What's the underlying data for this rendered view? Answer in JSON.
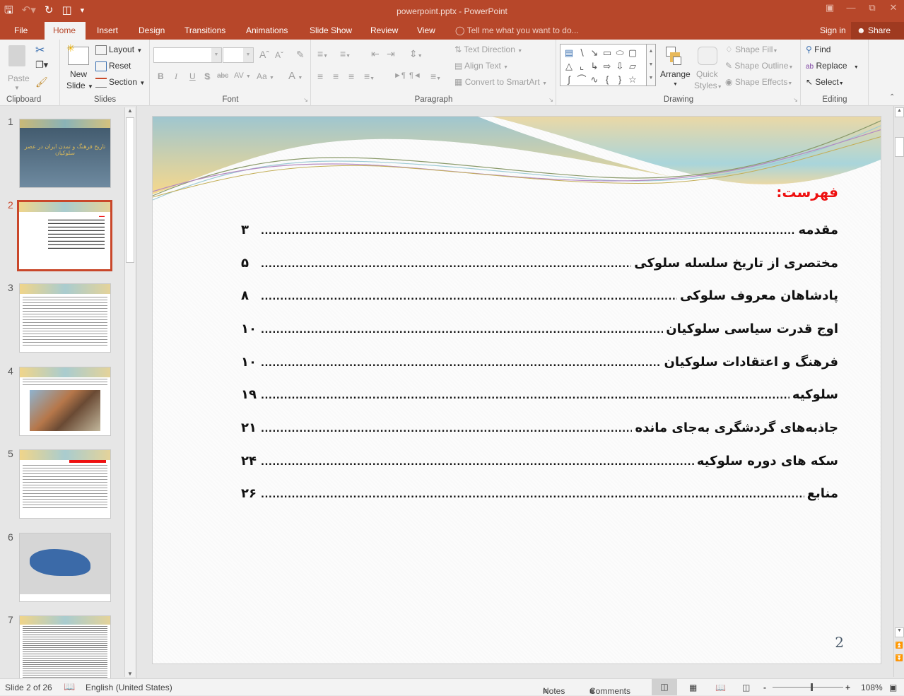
{
  "window": {
    "title": "powerpoint.pptx - PowerPoint",
    "qat": [
      "save-icon",
      "undo-icon",
      "redo-icon",
      "start-from-beginning-icon",
      "customize-qat-icon"
    ],
    "controls": [
      "ribbon-display-options",
      "minimize",
      "restore",
      "close"
    ]
  },
  "tabs": {
    "file": "File",
    "home": "Home",
    "insert": "Insert",
    "design": "Design",
    "transitions": "Transitions",
    "animations": "Animations",
    "slideshow": "Slide Show",
    "review": "Review",
    "view": "View",
    "tell_me": "Tell me what you want to do...",
    "sign_in": "Sign in",
    "share": "Share"
  },
  "ribbon": {
    "clipboard": {
      "label": "Clipboard",
      "paste": "Paste"
    },
    "slides": {
      "label": "Slides",
      "new_slide_1": "New",
      "new_slide_2": "Slide",
      "layout": "Layout",
      "reset": "Reset",
      "section": "Section"
    },
    "font": {
      "label": "Font",
      "font_name": "",
      "font_size": "",
      "bold": "B",
      "italic": "I",
      "underline": "U",
      "shadow": "S",
      "strike": "abc",
      "spacing": "AV",
      "case": "Aa",
      "color": "A"
    },
    "paragraph": {
      "label": "Paragraph",
      "text_direction": "Text Direction",
      "align_text": "Align Text",
      "convert_smartart": "Convert to SmartArt"
    },
    "drawing": {
      "label": "Drawing",
      "arrange": "Arrange",
      "quick_styles_1": "Quick",
      "quick_styles_2": "Styles",
      "shape_fill": "Shape Fill",
      "shape_outline": "Shape Outline",
      "shape_effects": "Shape Effects"
    },
    "editing": {
      "label": "Editing",
      "find": "Find",
      "replace": "Replace",
      "select": "Select"
    }
  },
  "thumbnails": [
    {
      "num": "1",
      "kind": "title",
      "title": "تاریخ فرهنگ و تمدن ایران در عصر سلوکیان"
    },
    {
      "num": "2",
      "kind": "toc",
      "selected": true
    },
    {
      "num": "3",
      "kind": "text"
    },
    {
      "num": "4",
      "kind": "image"
    },
    {
      "num": "5",
      "kind": "text"
    },
    {
      "num": "6",
      "kind": "map"
    },
    {
      "num": "7",
      "kind": "text"
    }
  ],
  "slide": {
    "title": "فهرست:",
    "entries": [
      {
        "label": "مقدمه",
        "page": "۳"
      },
      {
        "label": "مختصری از تاریخ سلسله سلوکی",
        "page": "۵"
      },
      {
        "label": "پادشاهان معروف سلوکی",
        "page": "۸"
      },
      {
        "label": "اوج قدرت سیاسی سلوکیان",
        "page": "۱۰"
      },
      {
        "label": "فرهنگ و اعتقادات سلوکیان",
        "page": "۱۰"
      },
      {
        "label": "سلوکیه",
        "page": "۱۹"
      },
      {
        "label": "جاذبه‌های گردشگری به‌جای مانده",
        "page": "۲۱"
      },
      {
        "label": "سکه های دوره سلوکیه",
        "page": "۲۴"
      },
      {
        "label": "منابع",
        "page": "۲۶"
      }
    ],
    "slide_number": "2",
    "title_color": "#ee1010"
  },
  "status": {
    "slide_of": "Slide 2 of 26",
    "language": "English (United States)",
    "notes": "Notes",
    "comments": "Comments",
    "zoom": "108%",
    "zoom_fraction": 0.54
  },
  "colors": {
    "accent": "#b7472a",
    "share_bg": "#9f3a20",
    "selected_thumb": "#c9472a"
  }
}
